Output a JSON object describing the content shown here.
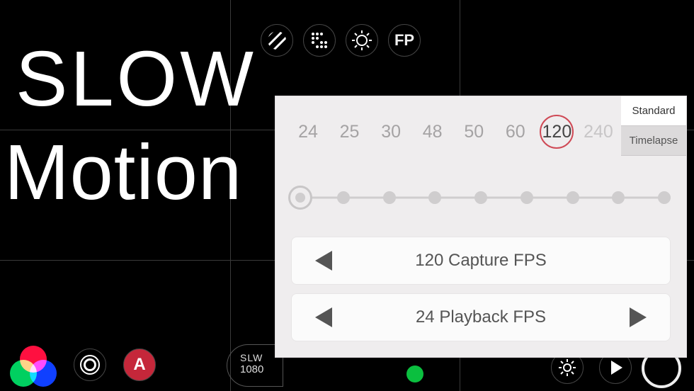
{
  "title": {
    "line1": "SLOW",
    "line2": "Motion"
  },
  "top_icons": [
    {
      "name": "zebra-icon"
    },
    {
      "name": "dots-grid-icon"
    },
    {
      "name": "sun-icon"
    },
    {
      "name": "fp-icon",
      "label": "FP"
    }
  ],
  "bottom_left": {
    "rgb_button": "rgb-channels-button",
    "focus_button": "focus-peaking-button",
    "a_button_label": "A"
  },
  "mode_badge": {
    "line1": "SLW",
    "line2": "1080"
  },
  "bottom_right": {
    "gear": "settings-icon",
    "play": "play-icon",
    "record": "record-button"
  },
  "panel": {
    "tabs": [
      {
        "label": "Standard",
        "active": true
      },
      {
        "label": "Timelapse",
        "active": false
      }
    ],
    "fps_values": [
      {
        "v": "24",
        "state": "normal"
      },
      {
        "v": "25",
        "state": "normal"
      },
      {
        "v": "30",
        "state": "normal"
      },
      {
        "v": "48",
        "state": "normal"
      },
      {
        "v": "50",
        "state": "normal"
      },
      {
        "v": "60",
        "state": "normal"
      },
      {
        "v": "120",
        "state": "selected"
      },
      {
        "v": "240",
        "state": "disabled"
      }
    ],
    "slider_nodes": 9,
    "capture_row": {
      "label": "120 Capture FPS"
    },
    "playback_row": {
      "label": "24 Playback FPS"
    }
  }
}
